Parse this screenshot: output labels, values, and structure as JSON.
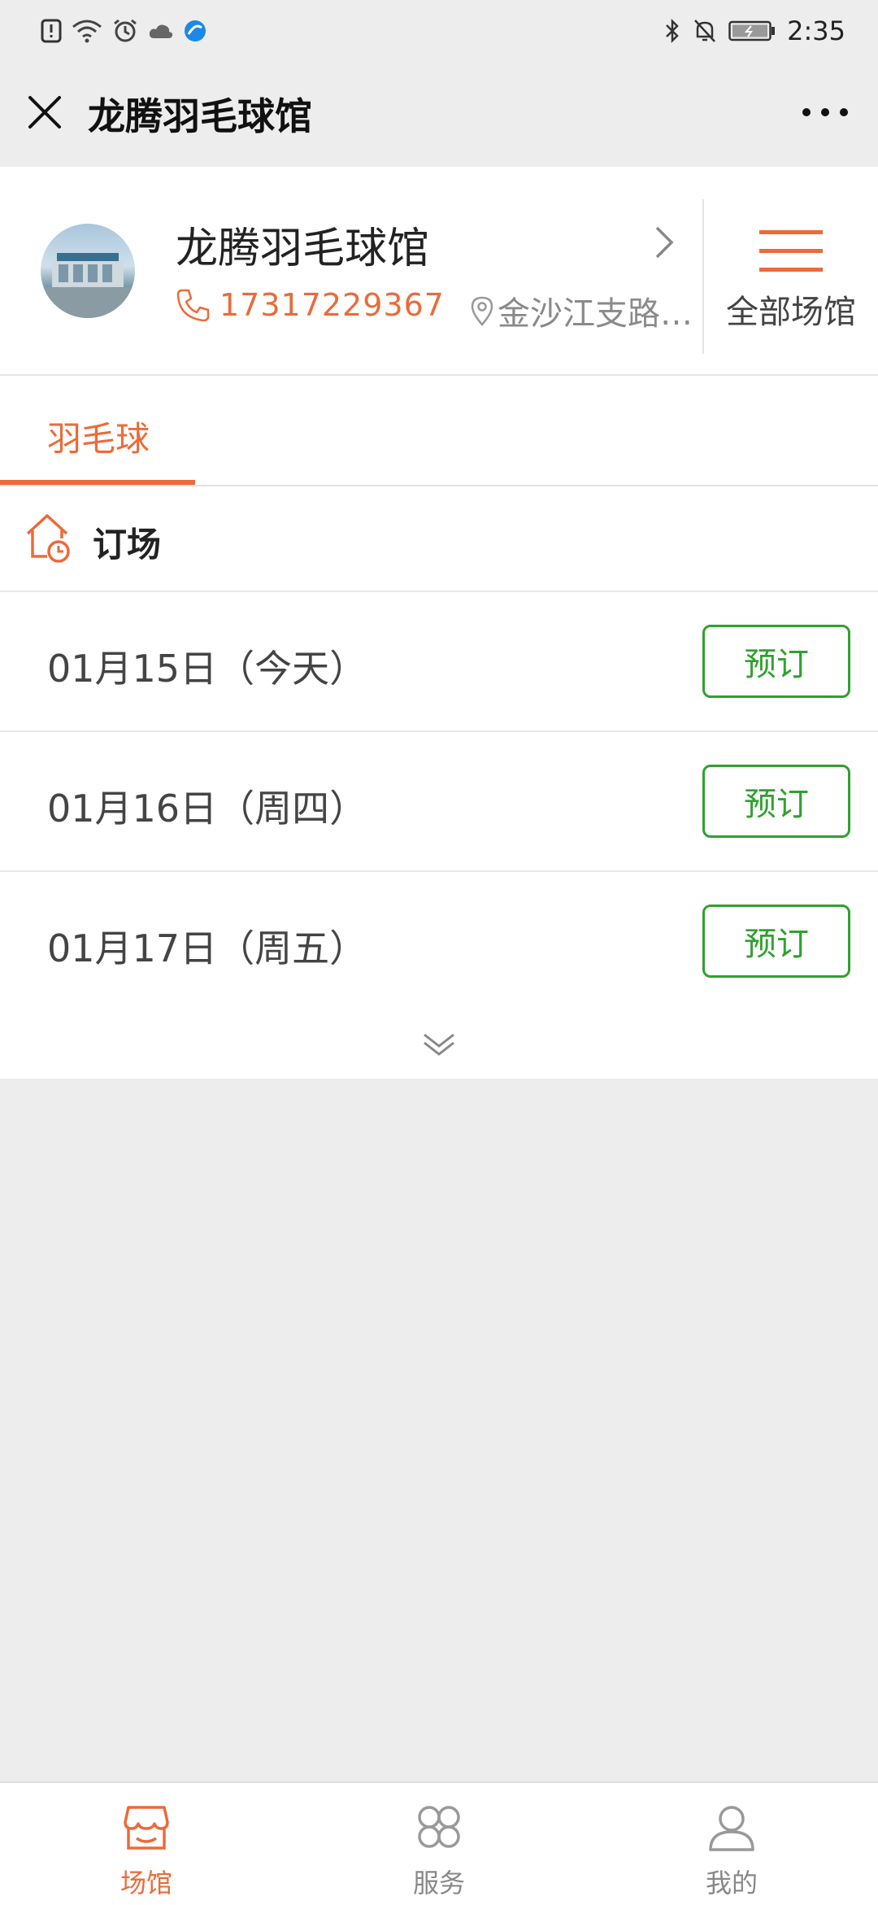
{
  "status_bar": {
    "time": "2:35",
    "icons_left": [
      "alert-icon",
      "wifi-icon",
      "alarm-icon",
      "cloud-icon",
      "browser-icon"
    ],
    "icons_right": [
      "bluetooth-icon",
      "mute-icon",
      "battery-icon"
    ]
  },
  "nav": {
    "title": "龙腾羽毛球馆",
    "close_icon": "close-icon",
    "more_icon": "more-icon"
  },
  "venue": {
    "name": "龙腾羽毛球馆",
    "phone": "17317229367",
    "address": "金沙江支路…",
    "all_venues_label": "全部场馆"
  },
  "tabs": [
    {
      "label": "羽毛球",
      "active": true
    }
  ],
  "booking": {
    "section_title": "订场",
    "dates": [
      {
        "label": "01月15日（今天）",
        "button": "预订"
      },
      {
        "label": "01月16日（周四）",
        "button": "预订"
      },
      {
        "label": "01月17日（周五）",
        "button": "预订"
      }
    ]
  },
  "tabbar": {
    "items": [
      {
        "label": "场馆",
        "icon": "store-icon",
        "active": true
      },
      {
        "label": "服务",
        "icon": "grid-icon",
        "active": false
      },
      {
        "label": "我的",
        "icon": "profile-icon",
        "active": false
      }
    ]
  },
  "colors": {
    "accent": "#ec6a3a",
    "book_green": "#2fa12f",
    "background": "#ededed"
  }
}
